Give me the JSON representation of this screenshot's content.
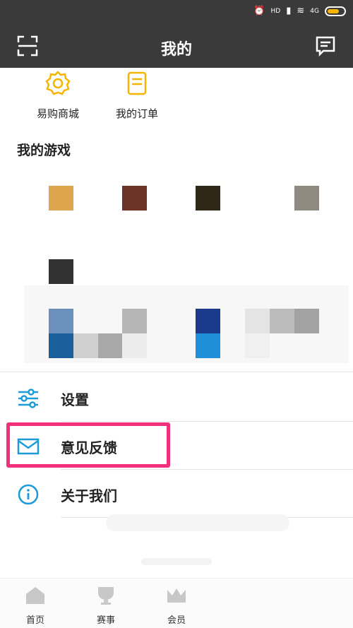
{
  "status_bar": {
    "hd": "HD",
    "signal": "4G"
  },
  "header": {
    "title": "我的"
  },
  "shortcuts": [
    {
      "label": "易购商城",
      "icon": "gift-badge-icon"
    },
    {
      "label": "我的订单",
      "icon": "order-list-icon"
    }
  ],
  "games_section": {
    "title": "我的游戏"
  },
  "menu": [
    {
      "label": "设置",
      "icon": "settings-sliders-icon"
    },
    {
      "label": "意见反馈",
      "icon": "mail-icon"
    },
    {
      "label": "关于我们",
      "icon": "info-icon"
    }
  ],
  "bottom_nav": [
    {
      "label": "首页",
      "icon": "home-icon"
    },
    {
      "label": "赛事",
      "icon": "trophy-cup-icon"
    },
    {
      "label": "会员",
      "icon": "crown-icon"
    }
  ],
  "colors": {
    "header_bg": "#3a3a3a",
    "accent_gold": "#f5b400",
    "accent_blue": "#1e9bd7",
    "highlight_pink": "#f0307a"
  }
}
